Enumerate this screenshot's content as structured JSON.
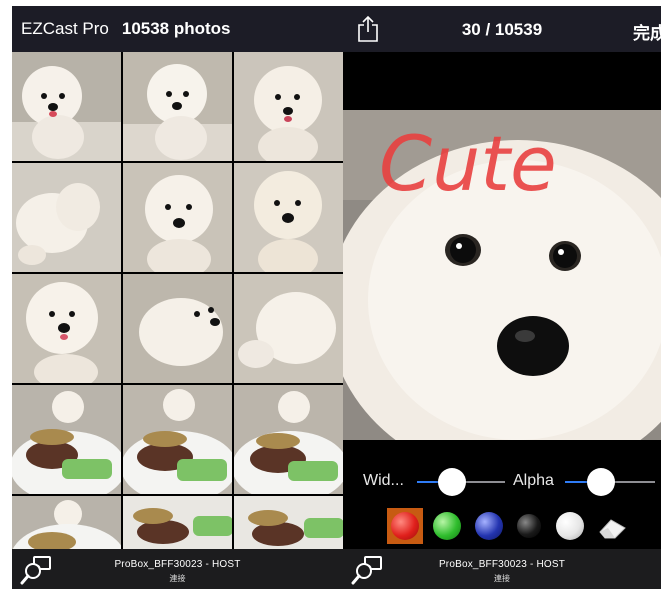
{
  "left": {
    "header": {
      "app_name": "EZCast Pro",
      "photo_count": "10538 photos"
    },
    "footer": {
      "device": "ProBox_BFF30023 - HOST",
      "status": "連接"
    }
  },
  "right": {
    "header": {
      "counter": "30 / 10539",
      "done_label": "完成"
    },
    "photo": {
      "annotation": "Cute"
    },
    "toolbar": {
      "width_label": "Wid...",
      "width_value": 0.4,
      "alpha_label": "Alpha",
      "alpha_value": 0.4,
      "colors": [
        {
          "name": "red",
          "hex": "#e0201c",
          "selected": true
        },
        {
          "name": "green",
          "hex": "#2fbd2d"
        },
        {
          "name": "blue",
          "hex": "#2334b0"
        },
        {
          "name": "black",
          "hex": "#1a1a1a"
        },
        {
          "name": "white",
          "hex": "#f2f2f2"
        }
      ],
      "eraser_icon": "eraser-icon"
    },
    "footer": {
      "device": "ProBox_BFF30023 - HOST",
      "status": "連接"
    }
  },
  "icons": {
    "cast": "cast-search-icon",
    "share": "share-icon"
  },
  "colors": {
    "header_bg": "#1c1c26",
    "accent": "#2f7cf6",
    "annotation": "#e8403f"
  }
}
